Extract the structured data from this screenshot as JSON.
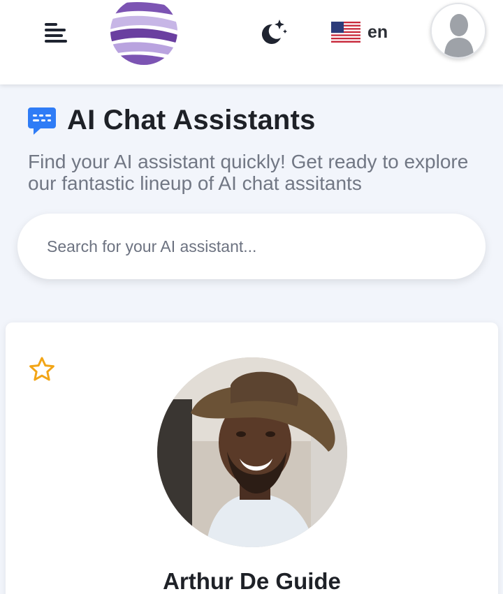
{
  "header": {
    "menu_icon": "hamburger-menu-icon",
    "logo_icon": "sphere-logo",
    "theme_icon": "moon-stars-icon",
    "language": {
      "flag_icon": "us-flag-icon",
      "code": "en"
    },
    "avatar_icon": "user-silhouette-icon"
  },
  "main": {
    "title_icon": "chat-bubble-icon",
    "title": "AI Chat Assistants",
    "subtitle": "Find your AI assistant quickly! Get ready to explore our fantastic lineup of AI chat assitants",
    "search": {
      "placeholder": "Search for your AI assistant..."
    }
  },
  "assistant_card": {
    "favorite_icon": "star-outline-icon",
    "name": "Arthur De Guide"
  },
  "colors": {
    "accent_blue": "#2f7cf6",
    "star": "#f2a516",
    "logo_purple": "#6a3fa0",
    "background": "#f2f5fb"
  }
}
